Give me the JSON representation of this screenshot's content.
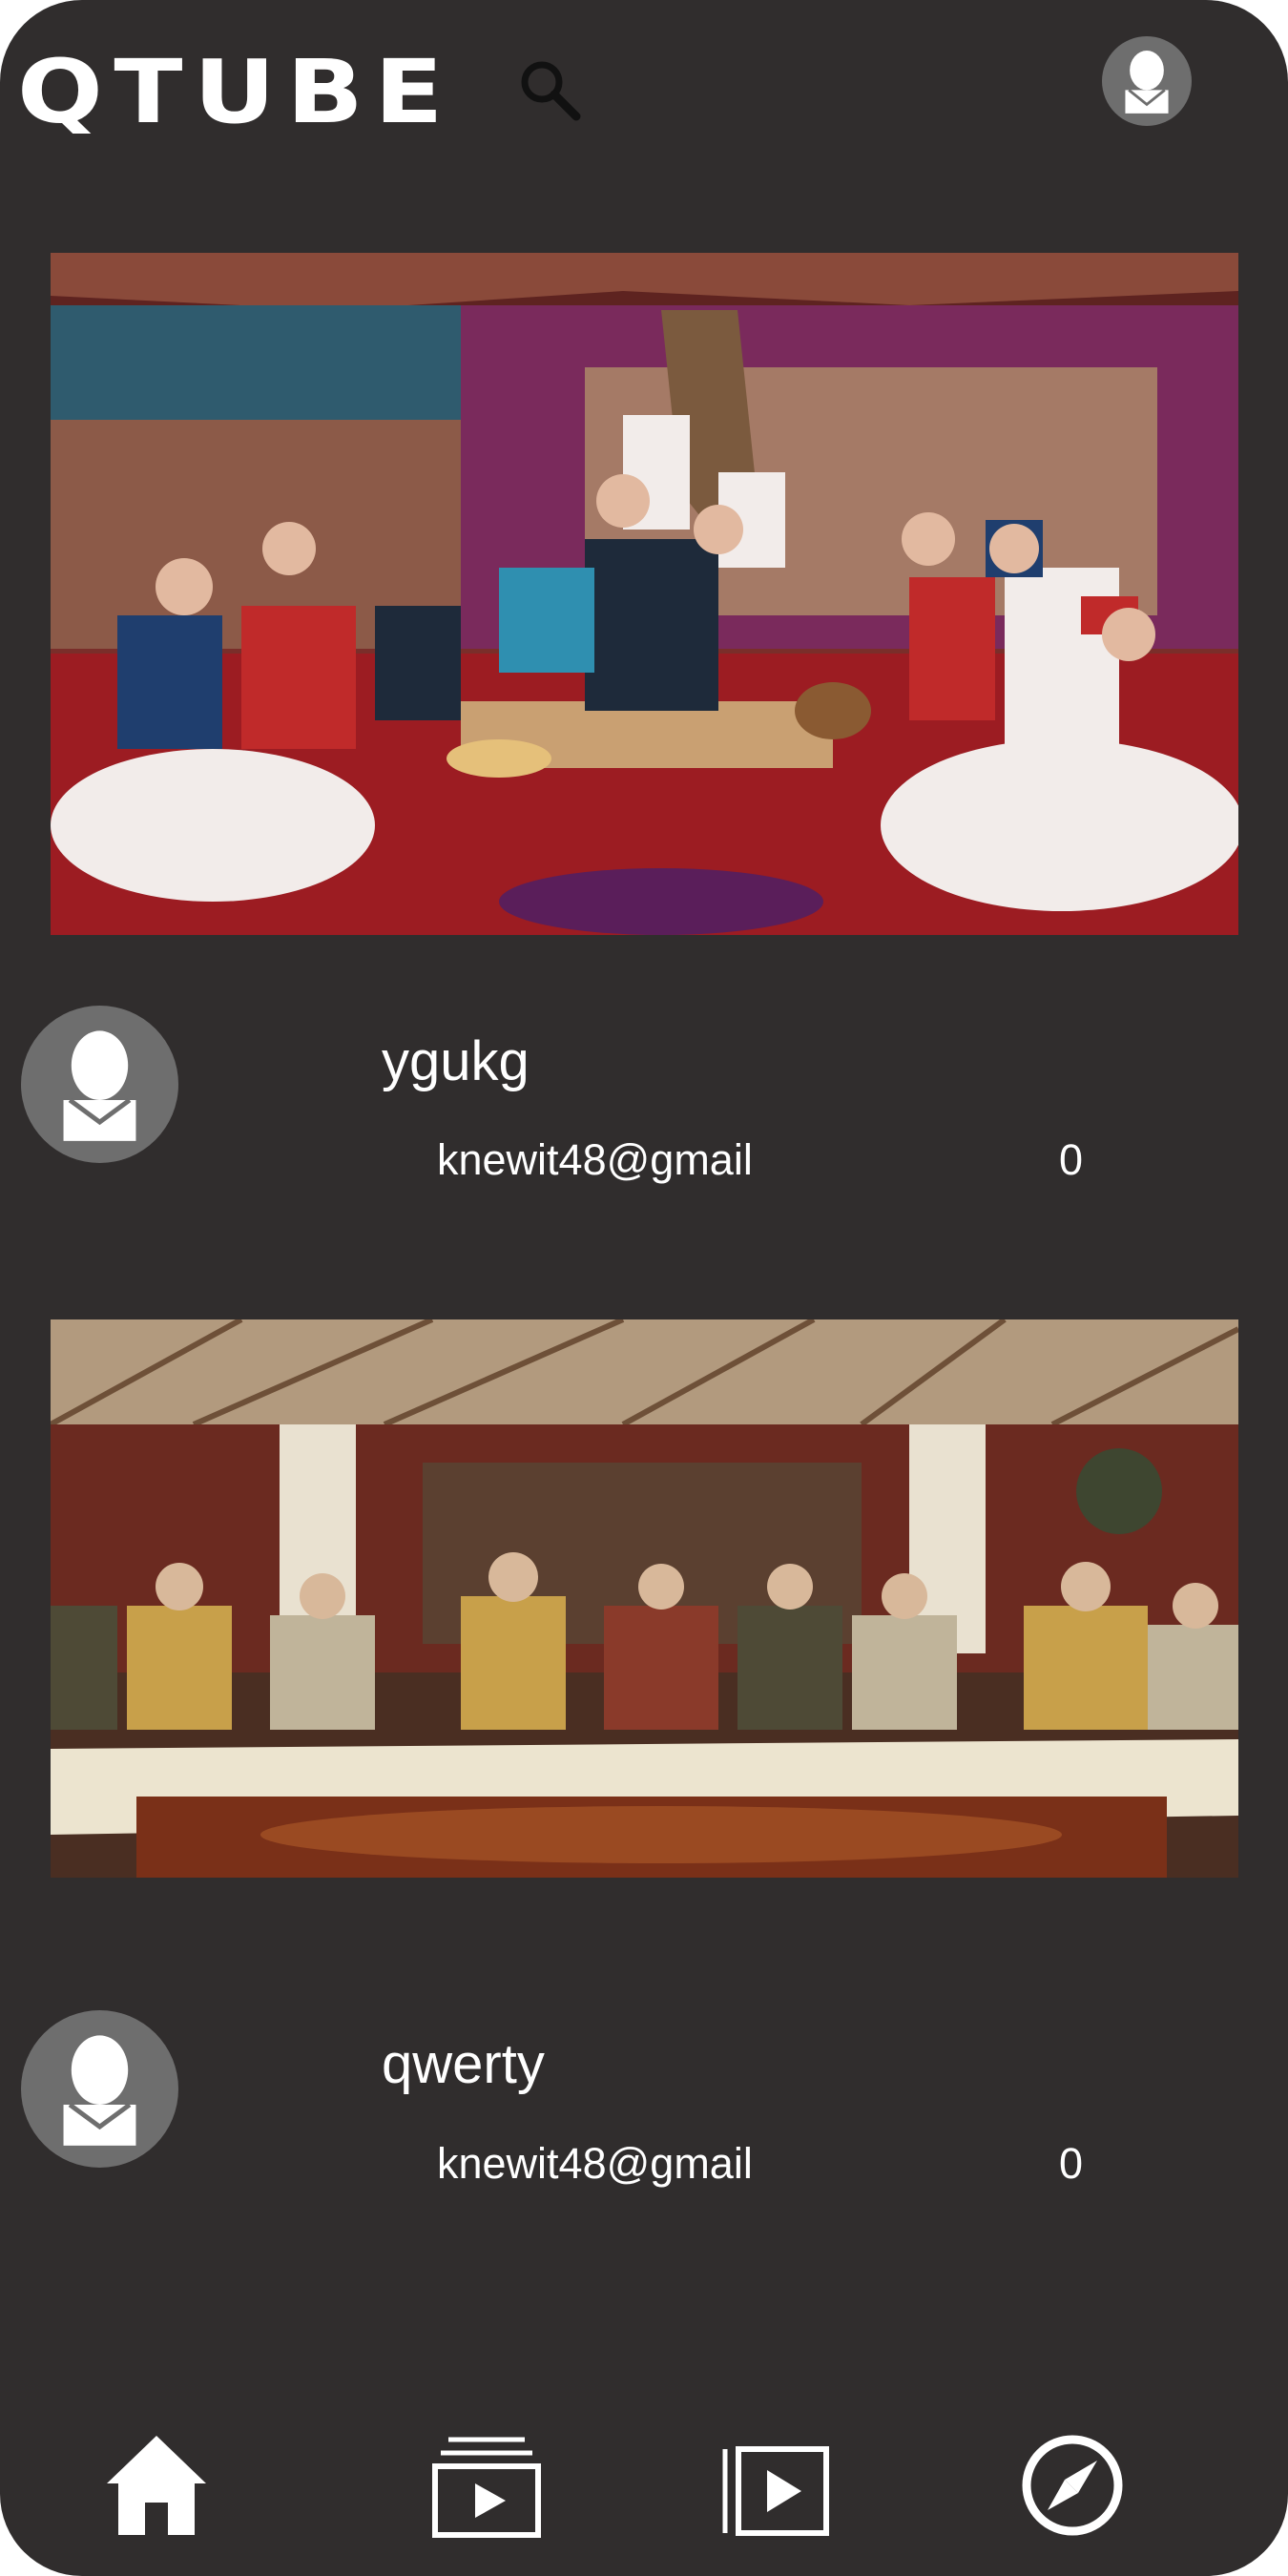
{
  "app": {
    "logo_text": "QTUBE"
  },
  "header": {
    "search_icon": "search-icon",
    "profile_icon": "user-avatar-icon"
  },
  "feed": {
    "videos": [
      {
        "title": "ygukg",
        "channel": "knewit48@gmail",
        "count": "0",
        "thumbnail": "family-feast-in-yurt-photo"
      },
      {
        "title": "qwerty",
        "channel": "knewit48@gmail",
        "count": "0",
        "thumbnail": "elders-banquet-in-yurt-photo"
      }
    ]
  },
  "bottom_nav": {
    "items": [
      "home-icon",
      "subscriptions-icon",
      "library-play-icon",
      "explore-compass-icon"
    ]
  },
  "colors": {
    "background": "#302d2d",
    "text": "#ffffff",
    "avatar_bg": "#6e6e6e"
  }
}
